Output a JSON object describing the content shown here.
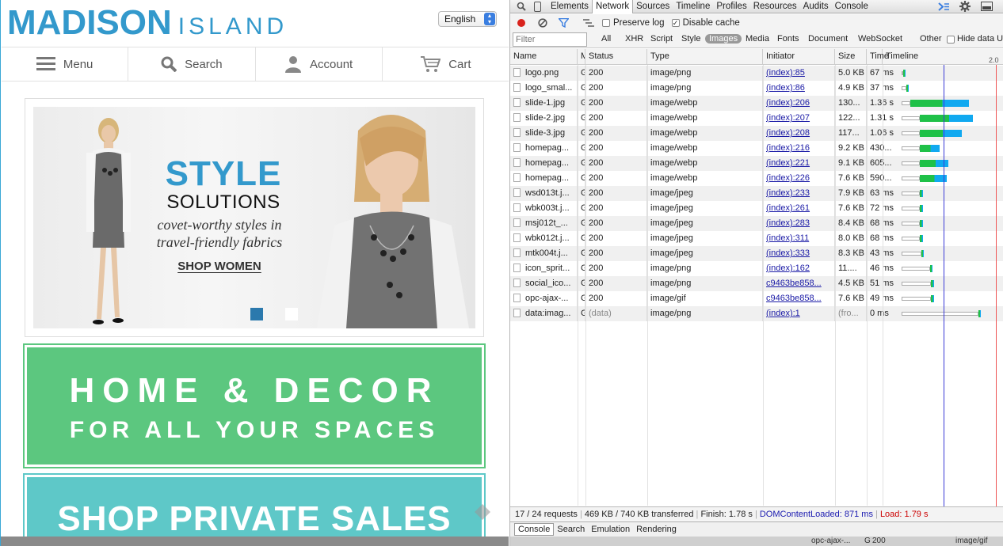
{
  "site": {
    "logo_main": "MADISON",
    "logo_sub": "ISLAND",
    "language": "English",
    "nav": [
      {
        "label": "Menu",
        "icon": "hamburger-icon"
      },
      {
        "label": "Search",
        "icon": "search-icon"
      },
      {
        "label": "Account",
        "icon": "user-icon"
      },
      {
        "label": "Cart",
        "icon": "cart-icon"
      }
    ],
    "hero": {
      "title": "STYLE",
      "subtitle": "SOLUTIONS",
      "tagline": "covet-worthy styles in travel-friendly fabrics",
      "cta": "SHOP WOMEN"
    },
    "banner_home": {
      "line1": "HOME & DECOR",
      "line2": "FOR ALL YOUR SPACES"
    },
    "banner_sales": {
      "line1": "SHOP PRIVATE SALES"
    },
    "colors": {
      "brand": "#3399cc",
      "green": "#5cc77f",
      "teal": "#5ec8c8"
    }
  },
  "devtools": {
    "tabs": [
      "Elements",
      "Network",
      "Sources",
      "Timeline",
      "Profiles",
      "Resources",
      "Audits",
      "Console"
    ],
    "active_tab": "Network",
    "preserve_log": "Preserve log",
    "disable_cache": "Disable cache",
    "filter_placeholder": "Filter",
    "types": [
      "All",
      "XHR",
      "Script",
      "Style",
      "Images",
      "Media",
      "Fonts",
      "Document",
      "WebSocket",
      "Other"
    ],
    "active_type": "Images",
    "hide_data": "Hide data U",
    "timeline_tick": "2.0",
    "columns": {
      "name": "Name",
      "method": "M",
      "status": "Status",
      "type": "Type",
      "initiator": "Initiator",
      "size": "Size",
      "time": "Time",
      "timeline": "Timeline"
    },
    "rows": [
      {
        "name": "logo.png",
        "m": "G",
        "status": "200",
        "type": "image/png",
        "initiator": "(index):85",
        "size": "5.0 KB",
        "time": "67 ms",
        "link": true,
        "bar": {
          "wait": 0.0,
          "recv": 0.01
        }
      },
      {
        "name": "logo_smal...",
        "m": "G",
        "status": "200",
        "type": "image/png",
        "initiator": "(index):86",
        "size": "4.9 KB",
        "time": "37 ms",
        "link": true,
        "bar": {
          "wait": 0.05,
          "recv": 0.01
        }
      },
      {
        "name": "slide-1.jpg",
        "m": "G",
        "status": "200",
        "type": "image/webp",
        "initiator": "(index):206",
        "size": "130...",
        "time": "1.36 s",
        "link": true,
        "bar": {
          "wait": 0.09,
          "recv": 0.6
        }
      },
      {
        "name": "slide-2.jpg",
        "m": "G",
        "status": "200",
        "type": "image/webp",
        "initiator": "(index):207",
        "size": "122...",
        "time": "1.31 s",
        "link": true,
        "bar": {
          "wait": 0.19,
          "recv": 0.54
        }
      },
      {
        "name": "slide-3.jpg",
        "m": "G",
        "status": "200",
        "type": "image/webp",
        "initiator": "(index):208",
        "size": "117...",
        "time": "1.06 s",
        "link": true,
        "bar": {
          "wait": 0.19,
          "recv": 0.43
        }
      },
      {
        "name": "homepag...",
        "m": "G",
        "status": "200",
        "type": "image/webp",
        "initiator": "(index):216",
        "size": "9.2 KB",
        "time": "430...",
        "link": true,
        "bar": {
          "wait": 0.19,
          "recv": 0.2
        }
      },
      {
        "name": "homepag...",
        "m": "G",
        "status": "200",
        "type": "image/webp",
        "initiator": "(index):221",
        "size": "9.1 KB",
        "time": "605...",
        "link": true,
        "bar": {
          "wait": 0.19,
          "recv": 0.29
        }
      },
      {
        "name": "homepag...",
        "m": "G",
        "status": "200",
        "type": "image/webp",
        "initiator": "(index):226",
        "size": "7.6 KB",
        "time": "590...",
        "link": true,
        "bar": {
          "wait": 0.19,
          "recv": 0.27
        }
      },
      {
        "name": "wsd013t.j...",
        "m": "G",
        "status": "200",
        "type": "image/jpeg",
        "initiator": "(index):233",
        "size": "7.9 KB",
        "time": "63 ms",
        "link": true,
        "bar": {
          "wait": 0.19,
          "recv": 0.03
        }
      },
      {
        "name": "wbk003t.j...",
        "m": "G",
        "status": "200",
        "type": "image/jpeg",
        "initiator": "(index):261",
        "size": "7.6 KB",
        "time": "72 ms",
        "link": true,
        "bar": {
          "wait": 0.19,
          "recv": 0.03
        }
      },
      {
        "name": "msj012t_...",
        "m": "G",
        "status": "200",
        "type": "image/jpeg",
        "initiator": "(index):283",
        "size": "8.4 KB",
        "time": "68 ms",
        "link": true,
        "bar": {
          "wait": 0.19,
          "recv": 0.03
        }
      },
      {
        "name": "wbk012t.j...",
        "m": "G",
        "status": "200",
        "type": "image/jpeg",
        "initiator": "(index):311",
        "size": "8.0 KB",
        "time": "68 ms",
        "link": true,
        "bar": {
          "wait": 0.19,
          "recv": 0.03
        }
      },
      {
        "name": "mtk004t.j...",
        "m": "G",
        "status": "200",
        "type": "image/jpeg",
        "initiator": "(index):333",
        "size": "8.3 KB",
        "time": "43 ms",
        "link": true,
        "bar": {
          "wait": 0.2,
          "recv": 0.03
        }
      },
      {
        "name": "icon_sprit...",
        "m": "G",
        "status": "200",
        "type": "image/png",
        "initiator": "(index):162",
        "size": "11....",
        "time": "46 ms",
        "link": true,
        "bar": {
          "wait": 0.29,
          "recv": 0.03
        }
      },
      {
        "name": "social_ico...",
        "m": "G",
        "status": "200",
        "type": "image/png",
        "initiator": "c9463be858...",
        "size": "4.5 KB",
        "time": "51 ms",
        "link": true,
        "bar": {
          "wait": 0.3,
          "recv": 0.03
        }
      },
      {
        "name": "opc-ajax-...",
        "m": "G",
        "status": "200",
        "type": "image/gif",
        "initiator": "c9463be858...",
        "size": "7.6 KB",
        "time": "49 ms",
        "link": true,
        "bar": {
          "wait": 0.3,
          "recv": 0.03
        }
      },
      {
        "name": "data:imag...",
        "m": "G",
        "status": "(data)",
        "type": "image/png",
        "initiator": "(index):1",
        "size": "(fro...",
        "time": "0 ms",
        "link": true,
        "bar": {
          "wait": 0.79,
          "recv": 0.01
        }
      }
    ],
    "status_bar": {
      "requests": "17 / 24 requests",
      "transferred": "469 KB / 740 KB transferred",
      "finish": "Finish: 1.78 s",
      "dcl": "DOMContentLoaded: 871 ms",
      "load": "Load: 1.79 s"
    },
    "drawer_tabs": [
      "Console",
      "Search",
      "Emulation",
      "Rendering"
    ],
    "bottom_row": {
      "name": "opc-ajax-...",
      "m": "G",
      "status": "200",
      "type": "image/gif"
    }
  }
}
